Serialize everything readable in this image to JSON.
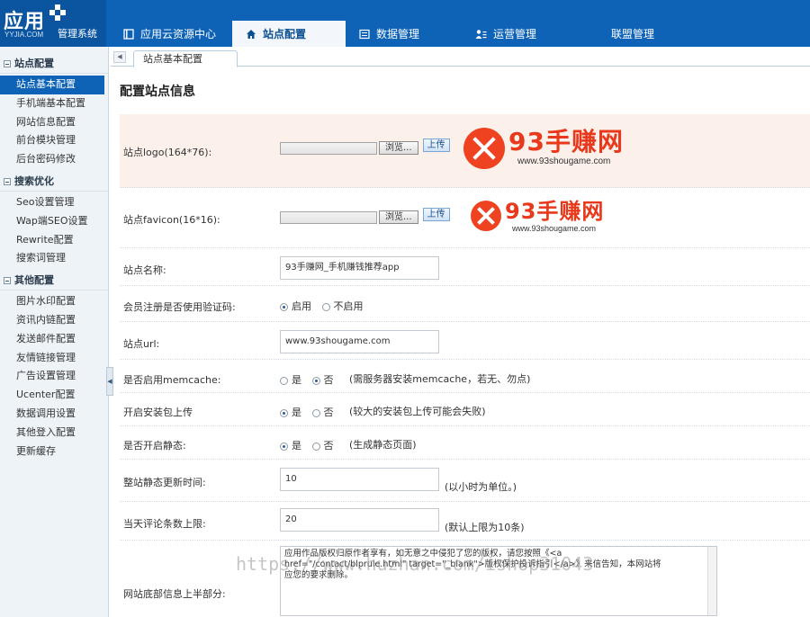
{
  "logo": {
    "main": "应用",
    "sub": "YYJIA.COM",
    "title": "管理系统"
  },
  "nav": [
    {
      "label": "应用云资源中心",
      "icon": "book-icon"
    },
    {
      "label": "站点配置",
      "icon": "home-icon"
    },
    {
      "label": "数据管理",
      "icon": "list-icon"
    },
    {
      "label": "运营管理",
      "icon": "users-icon"
    },
    {
      "label": "联盟管理",
      "icon": ""
    }
  ],
  "sidebar": {
    "groups": [
      {
        "title": "站点配置",
        "items": [
          "站点基本配置",
          "手机端基本配置",
          "网站信息配置",
          "前台模块管理",
          "后台密码修改"
        ]
      },
      {
        "title": "搜索优化",
        "items": [
          "Seo设置管理",
          "Wap端SEO设置",
          "Rewrite配置",
          "搜索词管理"
        ]
      },
      {
        "title": "其他配置",
        "items": [
          "图片水印配置",
          "资讯内链配置",
          "发送邮件配置",
          "友情链接管理",
          "广告设置管理",
          "Ucenter配置",
          "数据调用设置",
          "其他登入配置",
          "更新缓存"
        ]
      }
    ],
    "active": "站点基本配置"
  },
  "tab": {
    "current": "站点基本配置"
  },
  "page": {
    "title": "配置站点信息"
  },
  "form": {
    "browse_label": "浏览...",
    "upload_label": "上传",
    "logo": {
      "label": "站点logo(164*76):",
      "brand_cn": "93手赚网",
      "brand_url": "www.93shougame.com"
    },
    "favicon": {
      "label": "站点favicon(16*16):",
      "brand_cn": "93手赚网",
      "brand_url": "www.93shougame.com"
    },
    "site_name": {
      "label": "站点名称:",
      "value": "93手赚网_手机赚钱推荐app"
    },
    "captcha": {
      "label": "会员注册是否使用验证码:",
      "opt_on": "启用",
      "opt_off": "不启用"
    },
    "site_url": {
      "label": "站点url:",
      "value": "www.93shougame.com"
    },
    "memcache": {
      "label": "是否启用memcache:",
      "yes": "是",
      "no": "否",
      "hint": "(需服务器安装memcache，若无、勿点)"
    },
    "pkg_upload": {
      "label": "开启安装包上传",
      "yes": "是",
      "no": "否",
      "hint": "(较大的安装包上传可能会失败)"
    },
    "static": {
      "label": "是否开启静态:",
      "yes": "是",
      "no": "否",
      "hint": "(生成静态页面)"
    },
    "static_time": {
      "label": "整站静态更新时间:",
      "value": "10",
      "hint": "(以小时为单位。)"
    },
    "comment_limit": {
      "label": "当天评论条数上限:",
      "value": "20",
      "hint": "(默认上限为10条)"
    },
    "footer_top": {
      "label": "网站底部信息上半部分:",
      "line1": "应用作品版权归原作者享有，如无意之中侵犯了您的版权，请您按照《<a",
      "line2": "href=\"/contact/blprule.html\" target=\"_blank\">版权保护投诉指引</a>》来信告知，本网站将",
      "line3": "应您的要求删除。"
    }
  },
  "watermark": "https://www.huzhan.com/ishop31043"
}
